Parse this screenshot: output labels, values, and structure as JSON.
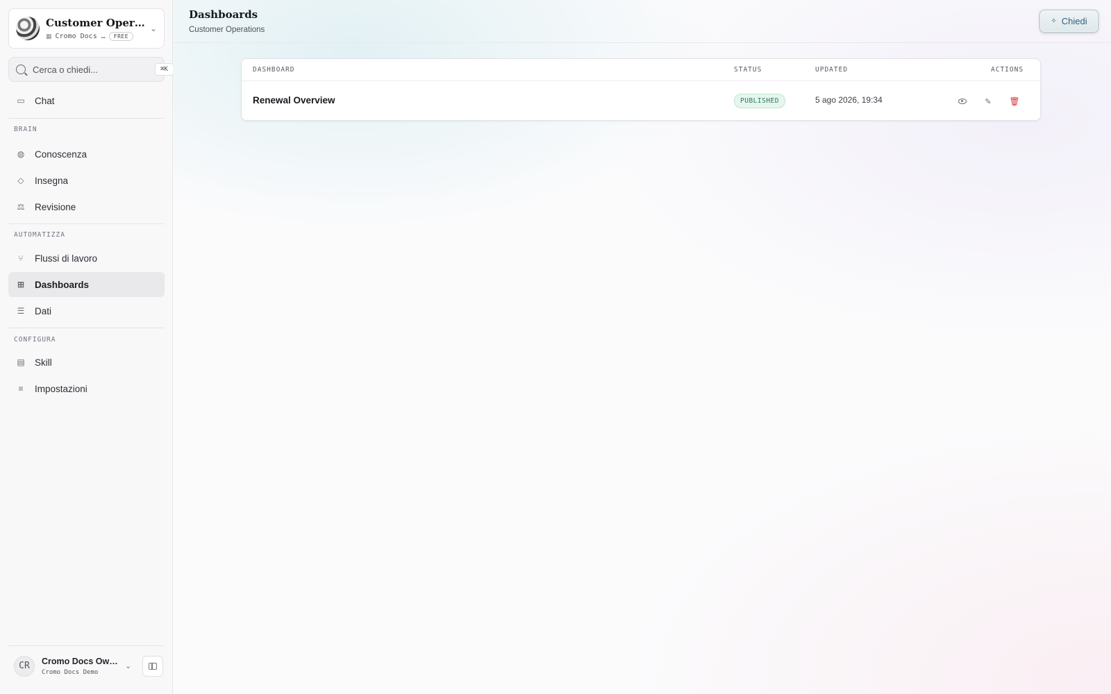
{
  "workspace": {
    "title": "Customer Operati…",
    "org_name": "Cromo Docs …",
    "plan_badge": "FREE"
  },
  "search": {
    "placeholder": "Cerca o chiedi...",
    "shortcut": "⌘K"
  },
  "nav": {
    "chat": "Chat",
    "sections": {
      "brain": "BRAIN",
      "automate": "AUTOMATIZZA",
      "configure": "CONFIGURA"
    },
    "items": {
      "knowledge": "Conoscenza",
      "teach": "Insegna",
      "review": "Revisione",
      "workflows": "Flussi di lavoro",
      "dashboards": "Dashboards",
      "data": "Dati",
      "skill": "Skill",
      "settings": "Impostazioni"
    },
    "active": "dashboards"
  },
  "user": {
    "initials": "CR",
    "name": "Cromo Docs Own…",
    "org": "Cromo Docs Demo"
  },
  "header": {
    "title": "Dashboards",
    "subtitle": "Customer Operations",
    "ask_label": "Chiedi"
  },
  "table": {
    "columns": {
      "dashboard": "DASHBOARD",
      "status": "STATUS",
      "updated": "UPDATED",
      "actions": "ACTIONS"
    },
    "rows": [
      {
        "name": "Renewal Overview",
        "status": "PUBLISHED",
        "updated": "5 ago 2026, 19:34",
        "actions": [
          "view-icon",
          "edit-icon",
          "delete-icon"
        ]
      }
    ]
  },
  "colors": {
    "status_published": "#2a7a56",
    "delete": "#d3383f",
    "ask_button_text": "#2e5f7a"
  }
}
